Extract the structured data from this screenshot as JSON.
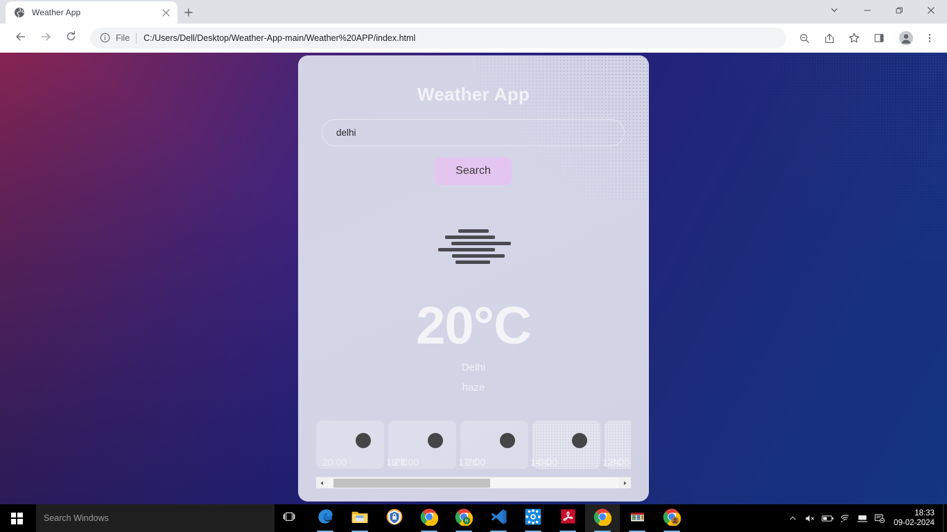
{
  "browser": {
    "tab": {
      "title": "Weather App",
      "favicon_icon": "globe-icon",
      "close_icon": "close-icon"
    },
    "new_tab_icon": "plus-icon",
    "window_controls": {
      "tab_search_icon": "chevron-down-icon",
      "minimize_icon": "minimize-icon",
      "maximize_icon": "restore-icon",
      "close_icon": "close-icon"
    },
    "nav": {
      "back_icon": "arrow-left-icon",
      "forward_icon": "arrow-right-icon",
      "reload_icon": "reload-icon"
    },
    "omnibox": {
      "info_icon": "info-circle-icon",
      "scheme_label": "File",
      "url": "C:/Users/Dell/Desktop/Weather-App-main/Weather%20APP/index.html"
    },
    "toolbar_icons": [
      {
        "name": "zoom-out-icon"
      },
      {
        "name": "share-icon"
      },
      {
        "name": "bookmark-star-icon"
      },
      {
        "name": "side-panel-icon"
      },
      {
        "name": "profile-avatar-icon"
      },
      {
        "name": "three-dot-menu-icon"
      }
    ]
  },
  "app": {
    "title": "Weather App",
    "search": {
      "value": "delhi",
      "placeholder": ""
    },
    "search_button_label": "Search",
    "search_button_color": "#e4c5ef",
    "weather_icon": "haze-icon",
    "temperature": "20°C",
    "city": "Delhi",
    "condition": "haze",
    "forecast": [
      {
        "time": "20:00",
        "temp": "19°C",
        "icon": "broken-image-icon",
        "textured": false
      },
      {
        "time": "23:00",
        "temp": "17°C",
        "icon": "broken-image-icon",
        "textured": false
      },
      {
        "time": "2:00",
        "temp": "14°C",
        "icon": "broken-image-icon",
        "textured": false
      },
      {
        "time": "5:00",
        "temp": "12°C",
        "icon": "broken-image-icon",
        "textured": true
      },
      {
        "time": "8:00",
        "temp": "",
        "icon": "broken-image-icon",
        "textured": true
      }
    ],
    "scrollbar": {
      "left_arrow_icon": "triangle-left-icon",
      "right_arrow_icon": "triangle-right-icon"
    }
  },
  "taskbar": {
    "start_icon": "windows-logo-icon",
    "search_placeholder": "Search Windows",
    "task_view_icon": "task-view-icon",
    "apps": [
      {
        "name": "edge-icon",
        "active": false,
        "running": true
      },
      {
        "name": "file-explorer-icon",
        "active": false,
        "running": true
      },
      {
        "name": "security-shield-icon",
        "active": false,
        "running": false
      },
      {
        "name": "chrome-icon",
        "active": false,
        "running": true
      },
      {
        "name": "chrome-r-icon",
        "active": false,
        "running": true
      },
      {
        "name": "vs-code-icon",
        "active": false,
        "running": true
      },
      {
        "name": "settings-gear-icon",
        "active": false,
        "running": true
      },
      {
        "name": "acrobat-reader-icon",
        "active": false,
        "running": true
      },
      {
        "name": "chrome-icon",
        "active": true,
        "running": true
      },
      {
        "name": "winrar-icon",
        "active": false,
        "running": true
      },
      {
        "name": "chrome-profile-icon",
        "active": false,
        "running": true
      }
    ],
    "tray": [
      {
        "name": "show-hidden-icons-icon"
      },
      {
        "name": "speaker-muted-icon"
      },
      {
        "name": "battery-icon"
      },
      {
        "name": "wifi-icon"
      },
      {
        "name": "display-icon"
      },
      {
        "name": "action-center-dnd-icon"
      }
    ],
    "time": "18:33",
    "date": "09-02-2024"
  }
}
